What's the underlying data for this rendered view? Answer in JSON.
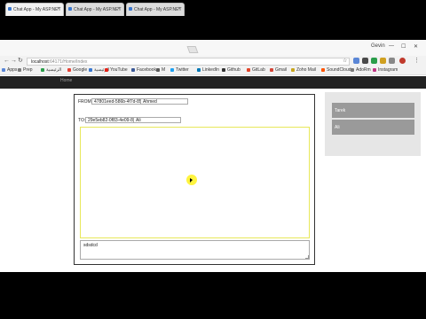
{
  "browser": {
    "tabs": [
      {
        "title": "Chat App - My ASP.NET"
      },
      {
        "title": "Chat App - My ASP.NET"
      },
      {
        "title": "Chat App - My ASP.NET"
      }
    ],
    "window_user": "Gevin",
    "url_host": "localhost",
    "url_rest": ":64171/Home/Index",
    "bookmarks": [
      {
        "label": "Apps",
        "color": "#5a86d6"
      },
      {
        "label": "Prep",
        "color": "#7a7a7a"
      },
      {
        "label": "الرئيسية",
        "color": "#2a9d4a"
      },
      {
        "label": "Google",
        "color": "#e44134"
      },
      {
        "label": "الرئيسية",
        "color": "#3a78d0"
      },
      {
        "label": "YouTube",
        "color": "#e62117"
      },
      {
        "label": "Facebook",
        "color": "#3b5998"
      },
      {
        "label": "M",
        "color": "#5a5a5a"
      },
      {
        "label": "Twitter",
        "color": "#1da1f2"
      },
      {
        "label": "LinkedIn",
        "color": "#0077b5"
      },
      {
        "label": "Github",
        "color": "#333333"
      },
      {
        "label": "GitLab",
        "color": "#e24329"
      },
      {
        "label": "Gmail",
        "color": "#d44638"
      },
      {
        "label": "Zoho Mail",
        "color": "#c8a51d"
      },
      {
        "label": "SoundCloud",
        "color": "#ff5500"
      },
      {
        "label": "AdoRm",
        "color": "#7a7a7a"
      },
      {
        "label": "Instagram",
        "color": "#c13584"
      }
    ]
  },
  "app": {
    "nav_link": "Home",
    "from_label": "FROM:",
    "from_id": "47801eed-586b-4f7d-8545",
    "from_name": "Ahmed",
    "to_label": "TO:",
    "to_id": "29e5eb82-0f83-4e09-8647",
    "to_name": "Ali",
    "message_input": "sdsdcd",
    "contacts": [
      {
        "label": "Tarek"
      },
      {
        "label": "Ali"
      }
    ]
  },
  "colors": {
    "nav_bg": "#222222",
    "contact_bg": "#9a9a9a",
    "message_border": "#e8e85a"
  }
}
